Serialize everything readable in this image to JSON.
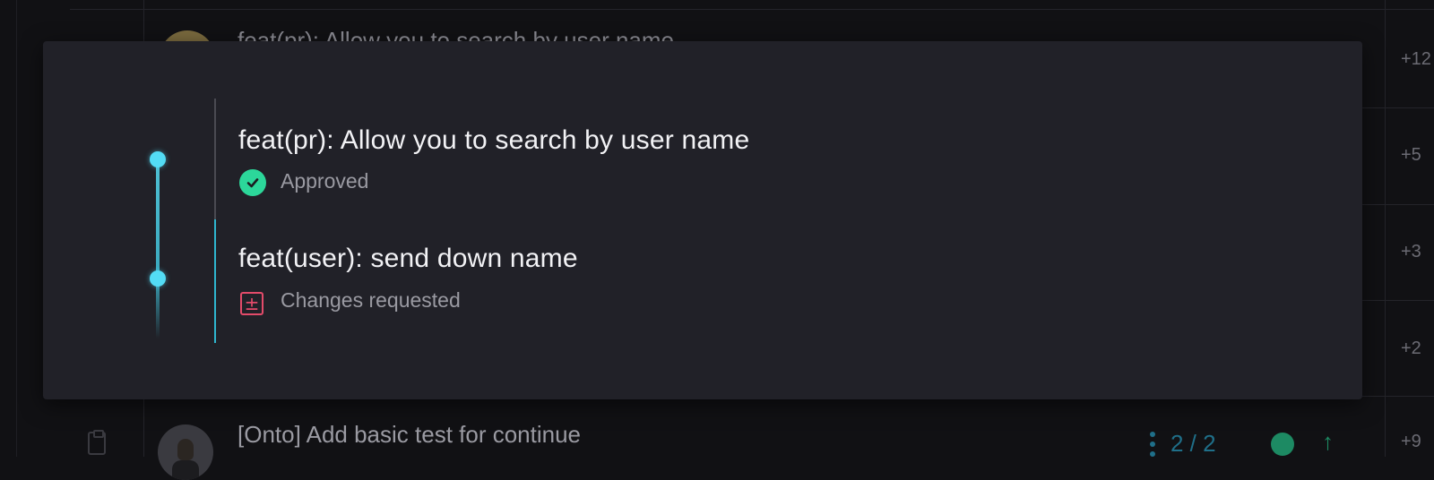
{
  "background": {
    "top_row_title": "feat(pr): Allow you to search by user name",
    "bottom_row_title": "[Onto] Add basic test for continue",
    "right_stats": [
      "+12",
      "+5",
      "+3",
      "+2",
      "+9"
    ],
    "pager": "2 / 2"
  },
  "modal": {
    "commits": [
      {
        "title": "feat(pr): Allow you to search by user name",
        "status": "Approved",
        "status_icon": "check-circle-icon",
        "status_color": "#2cd79a"
      },
      {
        "title": "feat(user): send down name",
        "status": "Changes requested",
        "status_icon": "plus-minus-square-icon",
        "status_color": "#e34b6a"
      }
    ],
    "accent": "#53dcf5"
  }
}
